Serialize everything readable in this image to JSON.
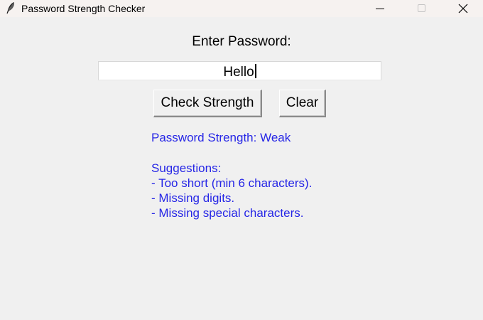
{
  "window": {
    "title": "Password Strength Checker",
    "icon": "feather-icon"
  },
  "form": {
    "label": "Enter Password:",
    "password_value": "Hello"
  },
  "buttons": {
    "check_label": "Check Strength",
    "clear_label": "Clear"
  },
  "result": {
    "strength_line": "Password Strength: Weak",
    "suggestions_heading": "Suggestions:",
    "suggestions": [
      "- Too short (min 6 characters).",
      "- Missing digits.",
      "- Missing special characters."
    ],
    "text_color": "#2626e6"
  }
}
